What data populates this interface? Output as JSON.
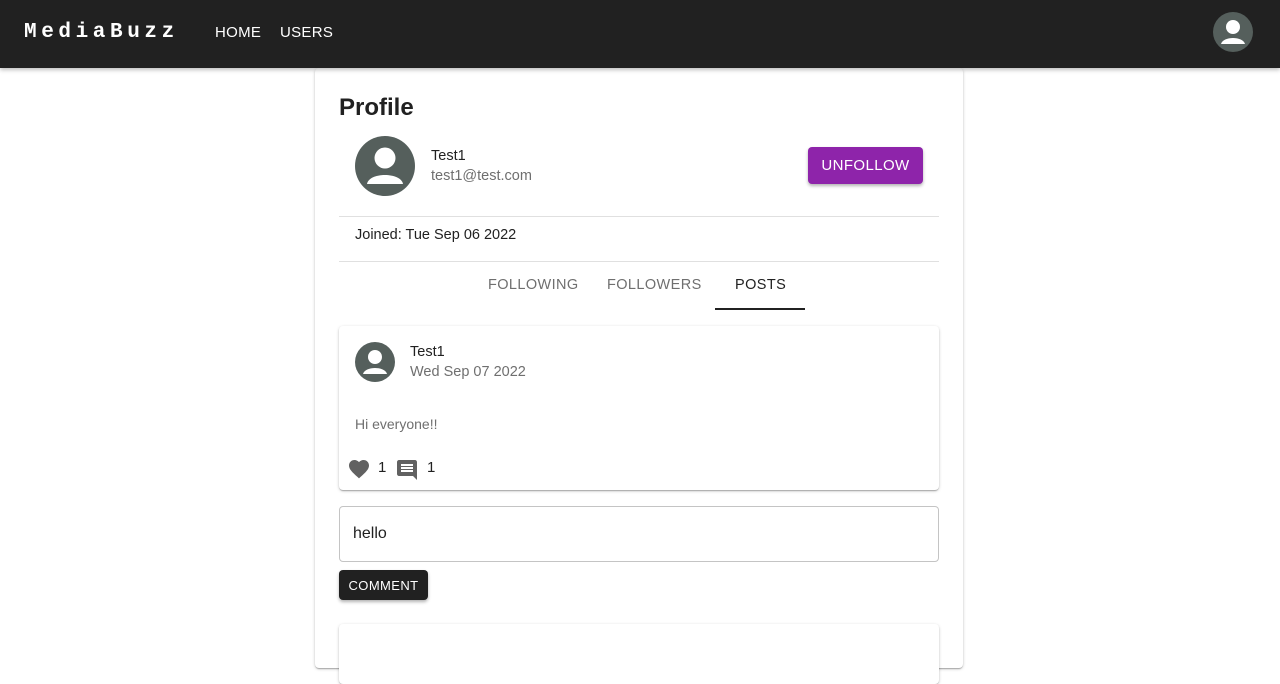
{
  "app": {
    "brand": "MediaBuzz",
    "nav": [
      {
        "label": "HOME"
      },
      {
        "label": "USERS"
      }
    ],
    "account_icon": "account-circle-icon"
  },
  "profile": {
    "title": "Profile",
    "name": "Test1",
    "email": "test1@test.com",
    "action_label": "UNFOLLOW",
    "joined": "Joined: Tue Sep 06 2022"
  },
  "tabs": [
    {
      "label": "FOLLOWING",
      "selected": false
    },
    {
      "label": "FOLLOWERS",
      "selected": false
    },
    {
      "label": "POSTS",
      "selected": true
    }
  ],
  "post": {
    "author": "Test1",
    "date": "Wed Sep 07 2022",
    "body": "Hi everyone!!",
    "like_icon": "heart-icon",
    "likes": "1",
    "comment_icon": "comment-icon",
    "comments": "1"
  },
  "comment_form": {
    "value": "hello",
    "button_label": "COMMENT"
  },
  "colors": {
    "appbar": "#212121",
    "accent": "#8e24aa",
    "avatar": "#555f5c"
  }
}
